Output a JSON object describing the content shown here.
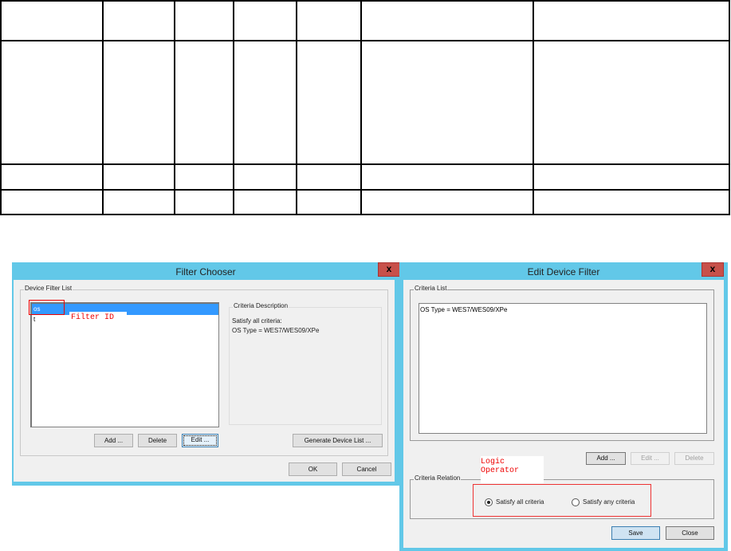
{
  "filter_chooser": {
    "title": "Filter Chooser",
    "close": "x",
    "group_label": "Device Filter List",
    "filters": [
      "os",
      "t"
    ],
    "annotation": "Filter ID",
    "criteria_group_label": "Criteria Description",
    "criteria_lines": [
      "Satisfy all criteria:",
      "OS Type = WES7/WES09/XPe"
    ],
    "buttons": {
      "add": "Add ...",
      "delete": "Delete",
      "edit": "Edit ...",
      "generate": "Generate Device List ...",
      "ok": "OK",
      "cancel": "Cancel"
    }
  },
  "edit_device_filter": {
    "title": "Edit Device Filter",
    "close": "x",
    "criteria_list_label": "Criteria List",
    "criteria": [
      "OS Type = WES7/WES09/XPe"
    ],
    "buttons": {
      "add": "Add ...",
      "edit": "Edit ...",
      "delete": "Delete",
      "save": "Save",
      "close": "Close"
    },
    "annotation": [
      "Logic",
      "Operator"
    ],
    "relation_label": "Criteria Relation",
    "relation_options": [
      {
        "label": "Satisfy all criteria",
        "selected": true
      },
      {
        "label": "Satisfy any criteria",
        "selected": false
      }
    ]
  }
}
